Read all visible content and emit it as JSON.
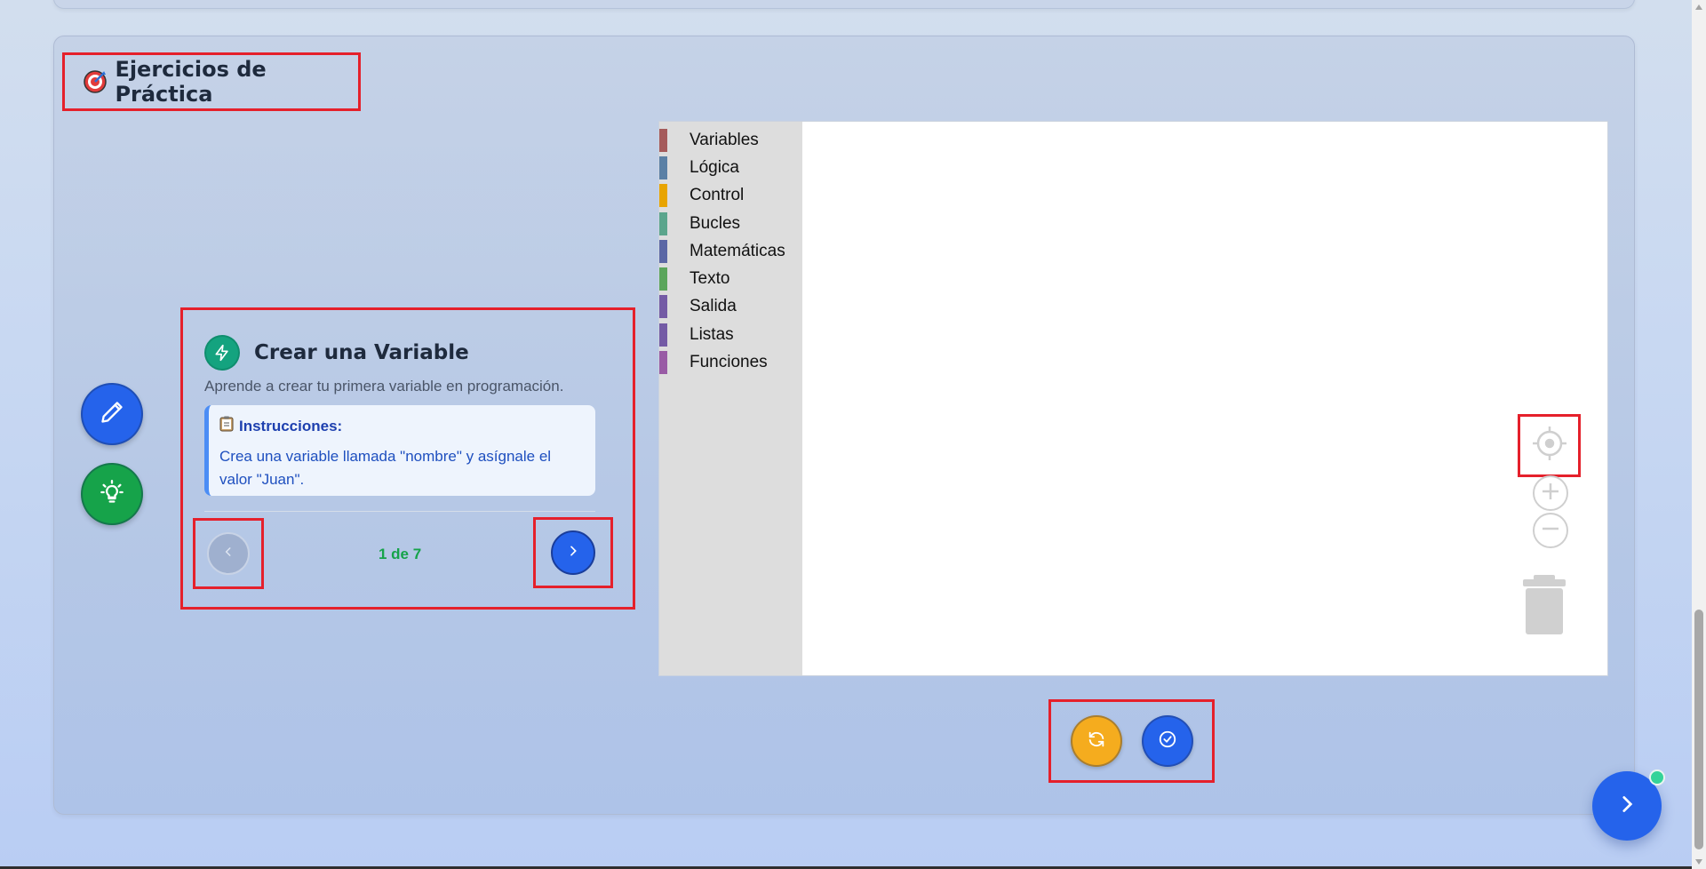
{
  "section": {
    "title": "Ejercicios de Práctica",
    "icon": "target-icon"
  },
  "sidebar_actions": [
    {
      "name": "edit",
      "icon": "pencil-icon",
      "color": "#2563eb"
    },
    {
      "name": "hint",
      "icon": "lightbulb-icon",
      "color": "#16a34a"
    }
  ],
  "exercise": {
    "icon": "lightning-icon",
    "title": "Crear una Variable",
    "description": "Aprende a crear tu primera variable en programación.",
    "instructions_label": "Instrucciones:",
    "instructions_icon": "clipboard-icon",
    "instructions_text": "Crea una variable llamada \"nombre\" y asígnale el valor \"Juan\".",
    "pager": "1 de 7",
    "prev_icon": "chevron-left-icon",
    "next_icon": "chevron-right-icon"
  },
  "toolbox": {
    "categories": [
      {
        "label": "Variables",
        "color": "#a55b5b"
      },
      {
        "label": "Lógica",
        "color": "#5b80a5"
      },
      {
        "label": "Control",
        "color": "#e8a400"
      },
      {
        "label": "Bucles",
        "color": "#5ba58c"
      },
      {
        "label": "Matemáticas",
        "color": "#5b67a5"
      },
      {
        "label": "Texto",
        "color": "#5ba55b"
      },
      {
        "label": "Salida",
        "color": "#745ba5"
      },
      {
        "label": "Listas",
        "color": "#745ba5"
      },
      {
        "label": "Funciones",
        "color": "#995ba5"
      }
    ]
  },
  "workspace_controls": {
    "recenter_icon": "crosshair-icon",
    "zoom_in_icon": "zoom-in-icon",
    "zoom_out_icon": "zoom-out-icon",
    "trash_icon": "trash-icon"
  },
  "actions": {
    "reset_icon": "refresh-icon",
    "check_icon": "check-circle-icon"
  },
  "colors": {
    "primary": "#2563eb",
    "success": "#16a34a",
    "warning": "#f5ac1e",
    "highlight": "#e5202b"
  }
}
